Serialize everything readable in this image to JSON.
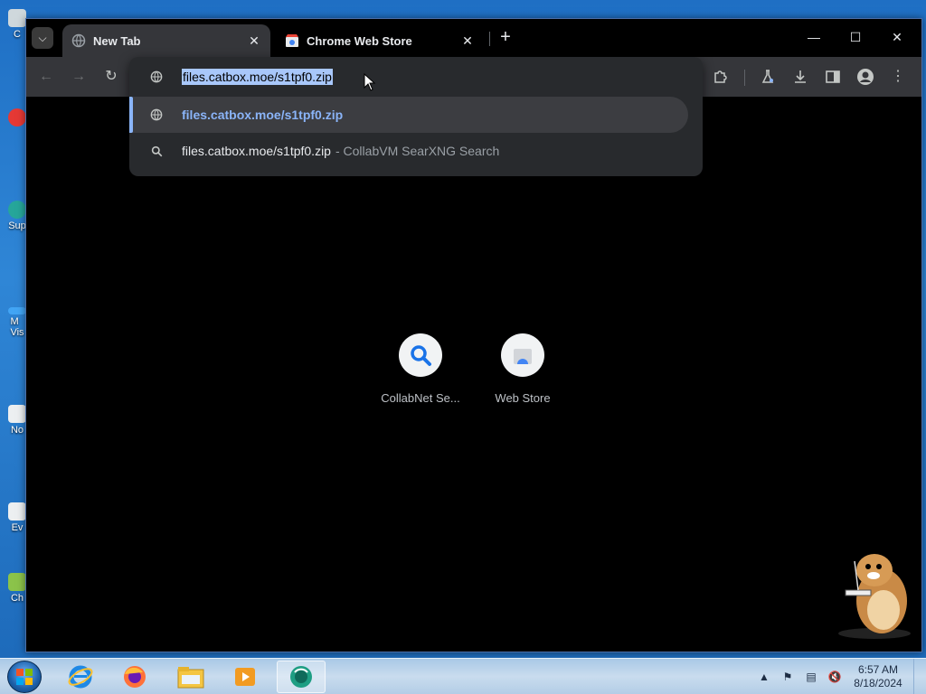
{
  "desktop": {
    "icons": [
      {
        "label": "C",
        "color": "#cfd8dc"
      },
      {
        "label": "",
        "color": "#e53935"
      },
      {
        "label": "Sup",
        "color": "#26a69a"
      },
      {
        "label": "M\nVis",
        "color": "#42a5f5"
      },
      {
        "label": "No",
        "color": "#eceff1"
      },
      {
        "label": "Ev",
        "color": "#eceff1"
      },
      {
        "label": "Ch",
        "color": "#8bc34a"
      }
    ]
  },
  "tabs": [
    {
      "label": "New Tab",
      "icon": "globe-icon",
      "active": true
    },
    {
      "label": "Chrome Web Store",
      "icon": "web-store-icon",
      "active": false
    }
  ],
  "omnibox": {
    "input_value": "files.catbox.moe/s1tpf0.zip",
    "suggestions": [
      {
        "text": "files.catbox.moe/s1tpf0.zip",
        "icon": "globe-icon"
      },
      {
        "text": "files.catbox.moe/s1tpf0.zip",
        "suffix": "- CollabVM SearXNG Search",
        "icon": "search-icon"
      }
    ]
  },
  "shortcuts": [
    {
      "label": "CollabNet Se...",
      "icon": "magnifier-icon"
    },
    {
      "label": "Web Store",
      "icon": "web-store-icon"
    }
  ],
  "taskbar": {
    "apps": [
      "internet-explorer-icon",
      "firefox-icon",
      "file-explorer-icon",
      "media-player-icon",
      "chrome-app-icon"
    ],
    "clock": {
      "time": "6:57 AM",
      "date": "8/18/2024"
    }
  },
  "colors": {
    "accent": "#8ab4f8",
    "selection": "#a8c7fa",
    "toolbar": "#35363a"
  }
}
